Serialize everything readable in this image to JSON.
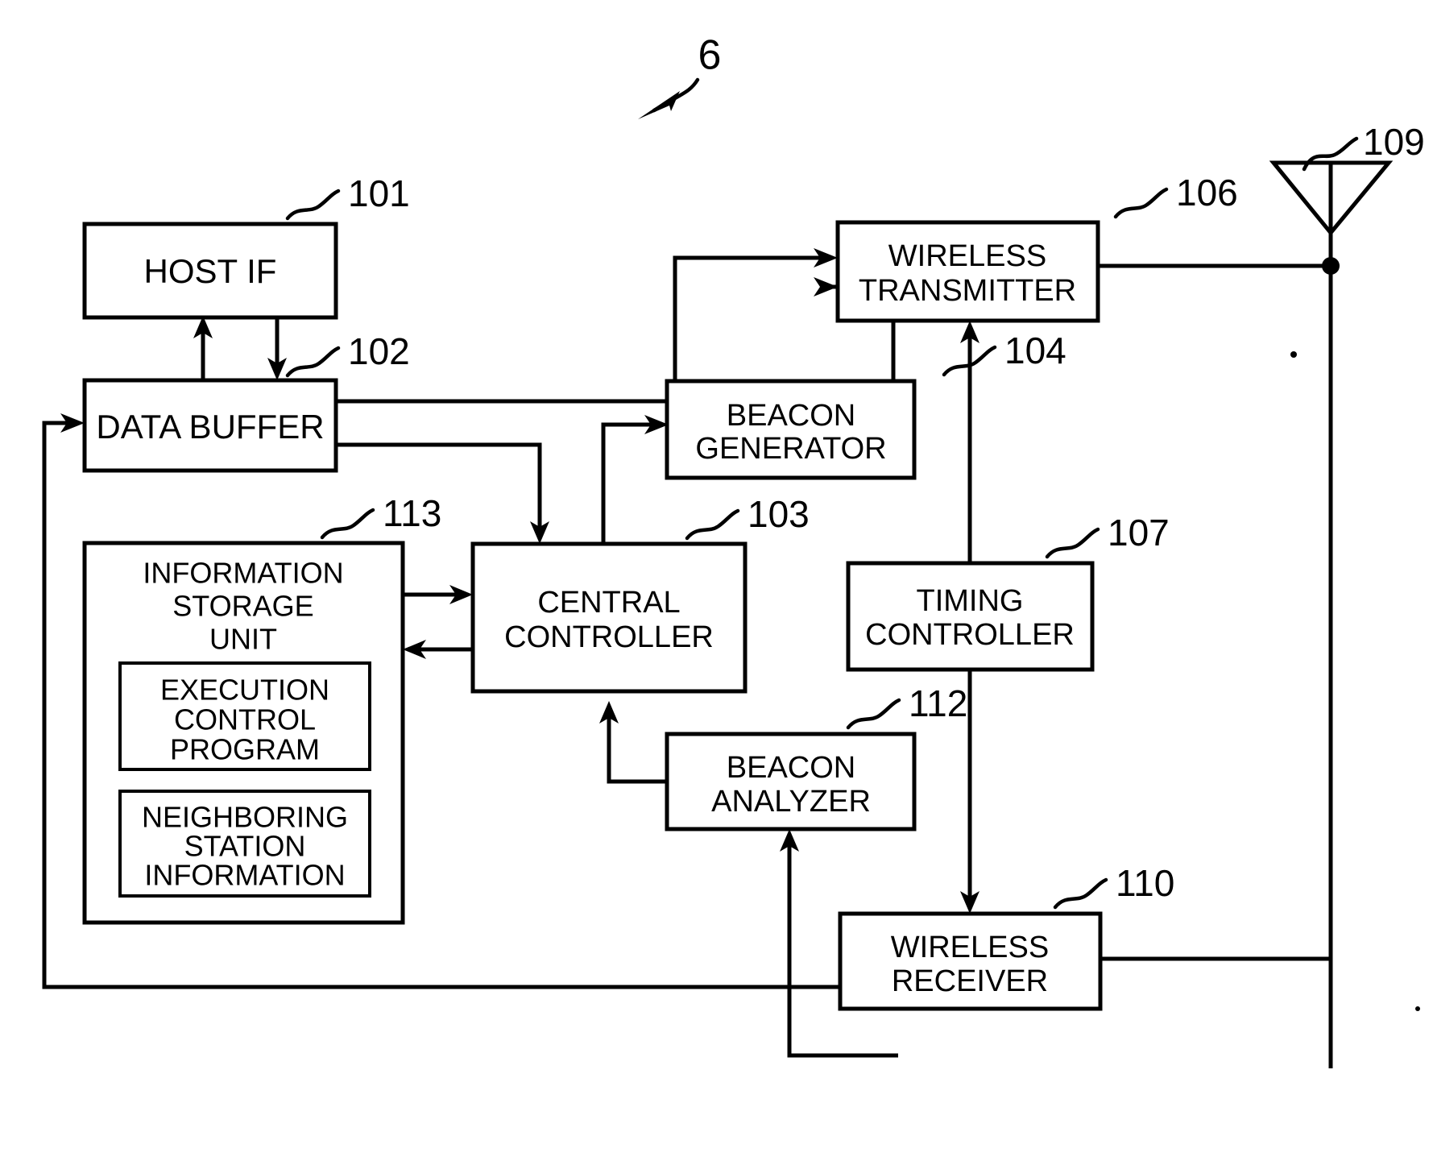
{
  "figure": {
    "number": "6",
    "type": "patent-block-diagram"
  },
  "blocks": {
    "host_if": {
      "label": "HOST IF",
      "ref": "101"
    },
    "data_buffer": {
      "label": "DATA BUFFER",
      "ref": "102"
    },
    "central_controller": {
      "label_line1": "CENTRAL",
      "label_line2": "CONTROLLER",
      "ref": "103"
    },
    "beacon_generator": {
      "label_line1": "BEACON",
      "label_line2": "GENERATOR",
      "ref": "104"
    },
    "wireless_transmitter": {
      "label_line1": "WIRELESS",
      "label_line2": "TRANSMITTER",
      "ref": "106"
    },
    "timing_controller": {
      "label_line1": "TIMING",
      "label_line2": "CONTROLLER",
      "ref": "107"
    },
    "antenna": {
      "ref": "109"
    },
    "wireless_receiver": {
      "label_line1": "WIRELESS",
      "label_line2": "RECEIVER",
      "ref": "110"
    },
    "beacon_analyzer": {
      "label_line1": "BEACON",
      "label_line2": "ANALYZER",
      "ref": "112"
    },
    "information_storage_unit": {
      "label_line1": "INFORMATION",
      "label_line2": "STORAGE",
      "label_line3": "UNIT",
      "ref": "113",
      "children": {
        "execution_control_program": {
          "label_line1": "EXECUTION",
          "label_line2": "CONTROL",
          "label_line3": "PROGRAM"
        },
        "neighboring_station_information": {
          "label_line1": "NEIGHBORING",
          "label_line2": "STATION",
          "label_line3": "INFORMATION"
        }
      }
    }
  },
  "colors": {
    "ink": "#000000",
    "paper": "#ffffff"
  }
}
